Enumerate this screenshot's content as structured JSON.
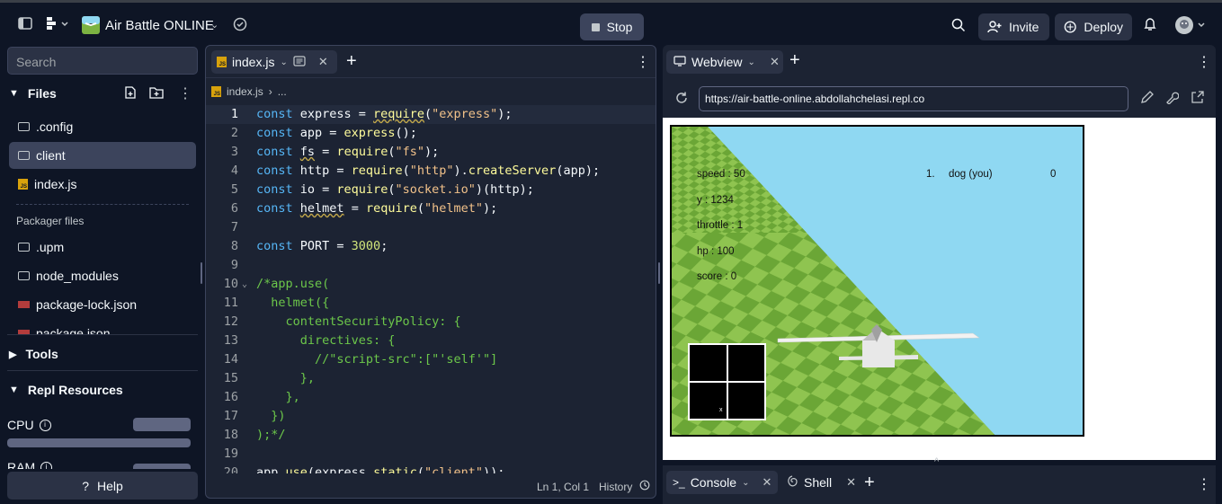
{
  "topbar": {
    "app_title": "Air Battle ONLINE",
    "stop_label": "Stop",
    "invite_label": "Invite",
    "deploy_label": "Deploy"
  },
  "sidebar": {
    "search_placeholder": "Search",
    "files_header": "Files",
    "files": [
      {
        "name": ".config",
        "type": "folder"
      },
      {
        "name": "client",
        "type": "folder"
      },
      {
        "name": "index.js",
        "type": "js"
      }
    ],
    "packager_label": "Packager files",
    "packager_files": [
      {
        "name": ".upm",
        "type": "folder"
      },
      {
        "name": "node_modules",
        "type": "folder"
      },
      {
        "name": "package-lock.json",
        "type": "json"
      },
      {
        "name": "package.json",
        "type": "json"
      }
    ],
    "tools_header": "Tools",
    "resources_header": "Repl Resources",
    "cpu_label": "CPU",
    "ram_label": "RAM",
    "help_label": "Help"
  },
  "editor": {
    "tab_label": "index.js",
    "breadcrumb_file": "index.js",
    "breadcrumb_more": "...",
    "lines": [
      "1",
      "2",
      "3",
      "4",
      "5",
      "6",
      "7",
      "8",
      "9",
      "10",
      "11",
      "12",
      "13",
      "14",
      "15",
      "16",
      "17",
      "18",
      "19",
      "20"
    ],
    "cursor_pos": "Ln 1, Col 1",
    "history_label": "History"
  },
  "webview": {
    "tab_label": "Webview",
    "url": "https://air-battle-online.abdollahchelasi.repl.co",
    "hud": {
      "speed": "speed : 50",
      "y": "y : 1234",
      "throttle": "throttle : 1",
      "hp": "hp : 100",
      "score": "score : 0"
    },
    "leaderboard": {
      "rank": "1.",
      "name": "dog (you)",
      "score": "0"
    }
  },
  "console": {
    "console_tab": "Console",
    "shell_tab": "Shell"
  },
  "colors": {
    "bg": "#0e1525",
    "panel": "#1c2333",
    "sky": "#8fd8f2",
    "grass_light": "#8fc450",
    "grass_dark": "#6ba636"
  }
}
